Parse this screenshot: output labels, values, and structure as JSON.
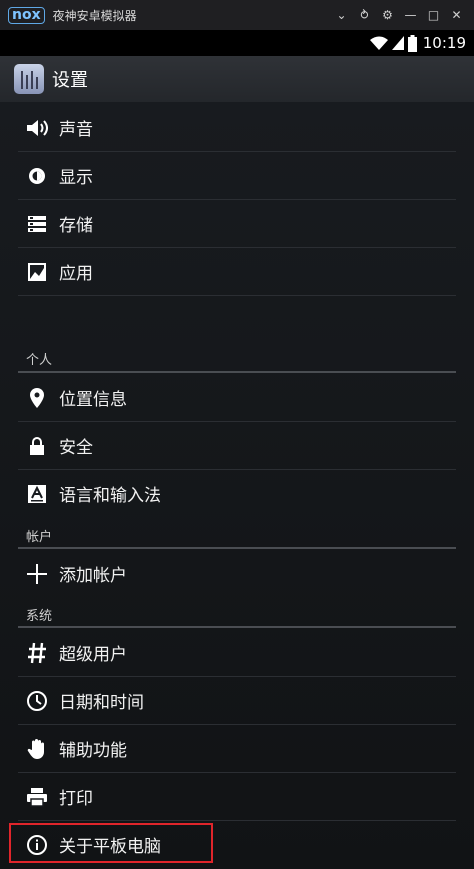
{
  "emulator": {
    "logo": "nox",
    "title": "夜神安卓模拟器",
    "controls": [
      "chevron-down-icon",
      "pin-icon",
      "gear-icon",
      "minimize-icon",
      "maximize-icon",
      "close-icon"
    ]
  },
  "status_bar": {
    "time": "10:19"
  },
  "action_bar": {
    "title": "设置"
  },
  "sections": {
    "device": {
      "items": [
        {
          "label": "声音",
          "icon": "volume-icon"
        },
        {
          "label": "显示",
          "icon": "brightness-icon"
        },
        {
          "label": "存储",
          "icon": "storage-icon"
        },
        {
          "label": "应用",
          "icon": "apps-icon"
        }
      ]
    },
    "personal": {
      "header": "个人",
      "items": [
        {
          "label": "位置信息",
          "icon": "location-icon"
        },
        {
          "label": "安全",
          "icon": "lock-icon"
        },
        {
          "label": "语言和输入法",
          "icon": "language-icon"
        }
      ]
    },
    "accounts": {
      "header": "帐户",
      "items": [
        {
          "label": "添加帐户",
          "icon": "add-icon"
        }
      ]
    },
    "system": {
      "header": "系统",
      "items": [
        {
          "label": "超级用户",
          "icon": "hash-icon"
        },
        {
          "label": "日期和时间",
          "icon": "clock-icon"
        },
        {
          "label": "辅助功能",
          "icon": "hand-icon"
        },
        {
          "label": "打印",
          "icon": "printer-icon"
        },
        {
          "label": "关于平板电脑",
          "icon": "info-icon"
        }
      ]
    }
  },
  "colors": {
    "highlight": "#e0252b",
    "background": "#15181b",
    "accent": "#7ec3ff"
  }
}
